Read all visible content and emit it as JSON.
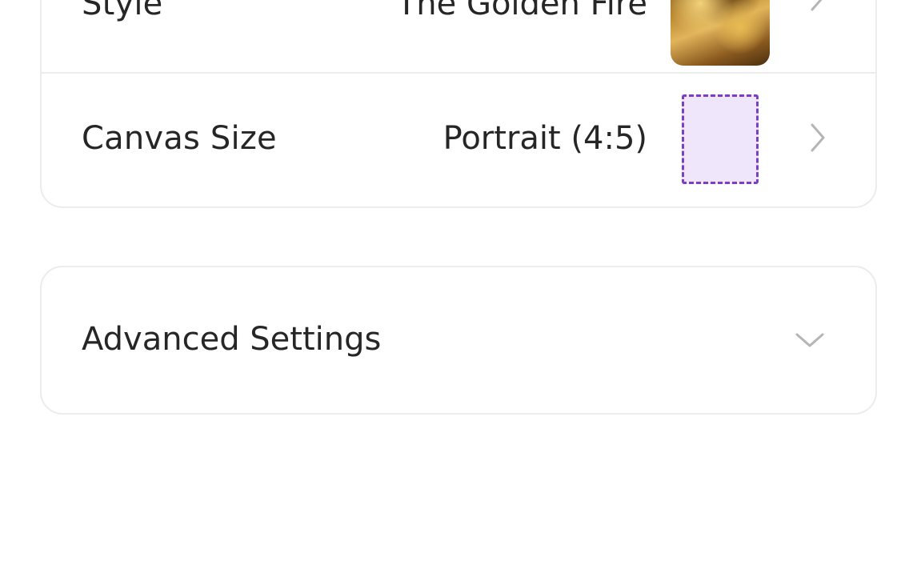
{
  "settings": {
    "style": {
      "label": "Style",
      "value": "The Golden Fire",
      "thumbnail_icon": "golden-fire-style-thumbnail"
    },
    "canvas_size": {
      "label": "Canvas Size",
      "value": "Portrait (4:5)",
      "thumbnail_icon": "portrait-canvas-preview"
    }
  },
  "advanced": {
    "label": "Advanced Settings",
    "expand_icon": "chevron-down-icon"
  },
  "colors": {
    "accent": "#7b3fc4",
    "canvas_preview_fill": "#efe6fb",
    "card_border": "#ececec",
    "text": "#262626",
    "chevron": "#b5b5b5"
  }
}
